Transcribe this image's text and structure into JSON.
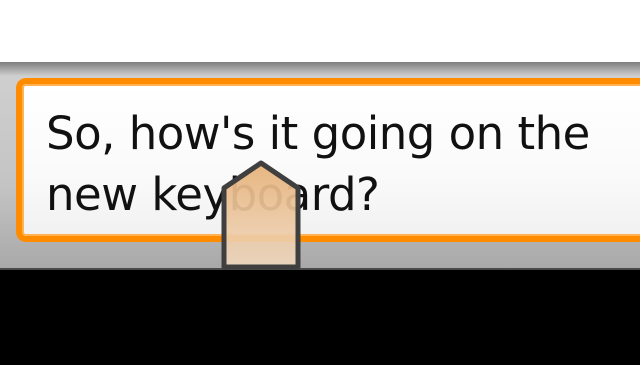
{
  "compose": {
    "message_text": "So, how's it going on the\nnew keyboard?"
  },
  "colors": {
    "focus_border": "#ff8c00",
    "handle_fill": "#d9b48f",
    "bar_background": "#c4c4c4"
  },
  "icons": {
    "cursor_handle": "text-cursor-handle-icon"
  }
}
